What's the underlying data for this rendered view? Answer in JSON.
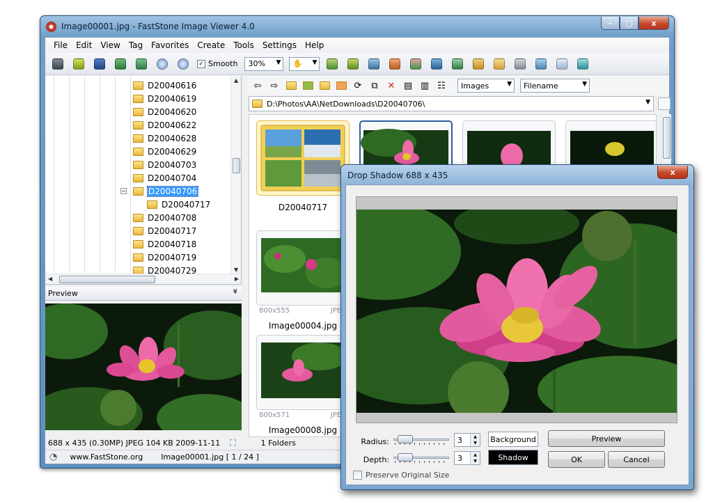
{
  "window": {
    "title": "Image00001.jpg  -  FastStone Image Viewer 4.0",
    "controls": {
      "minimize": "–",
      "maximize": "▢",
      "close": "x"
    }
  },
  "menu": [
    "File",
    "Edit",
    "View",
    "Tag",
    "Favorites",
    "Create",
    "Tools",
    "Settings",
    "Help"
  ],
  "toolbar": {
    "smooth_label": "Smooth",
    "smooth_checked": "✓",
    "zoom_value": "30%",
    "hand_icon": "✋"
  },
  "tree": {
    "items": [
      "D20040616",
      "D20040619",
      "D20040620",
      "D20040622",
      "D20040628",
      "D20040629",
      "D20040703",
      "D20040704",
      "D20040706",
      "D20040717",
      "D20040708",
      "D20040717",
      "D20040718",
      "D20040719",
      "D20040729"
    ],
    "selected_index": 8,
    "child_index": 9,
    "expander_symbol": "−"
  },
  "preview": {
    "label": "Preview",
    "collapse_symbol": "¥"
  },
  "browser": {
    "filter_value": "Images",
    "sort_value": "Filename",
    "path": "D:\\Photos\\AA\\NetDownloads\\D20040706\\",
    "delete_symbol": "✕",
    "thumbnails": [
      {
        "name": "D20040717"
      },
      {
        "name": "Image00004.jpg",
        "size": "800x555",
        "format": "JPEG"
      },
      {
        "name": "Image00008.jpg",
        "size": "800x571",
        "format": "JPEG"
      }
    ],
    "folders_count": "1 Folders"
  },
  "status": {
    "image_info": "688 x 435 (0.30MP)  JPEG    104 KB    2009-11-11",
    "website": "www.FastStone.org",
    "file_position": "Image00001.jpg [ 1 / 24 ]"
  },
  "dialog": {
    "title": "Drop Shadow    688 x 435",
    "close": "x",
    "radius_label": "Radius:",
    "radius_value": "3",
    "depth_label": "Depth:",
    "depth_value": "3",
    "background_label": "Background",
    "shadow_label": "Shadow",
    "preview_button": "Preview",
    "ok_button": "OK",
    "cancel_button": "Cancel",
    "preserve_label": "Preserve Original Size"
  },
  "colors": {
    "selection": "#3399ff",
    "shadow_swatch": "#000000",
    "background_swatch": "#ffffff",
    "lotus_pink": "#e94a9a",
    "leaf_green": "#2f6b24"
  }
}
